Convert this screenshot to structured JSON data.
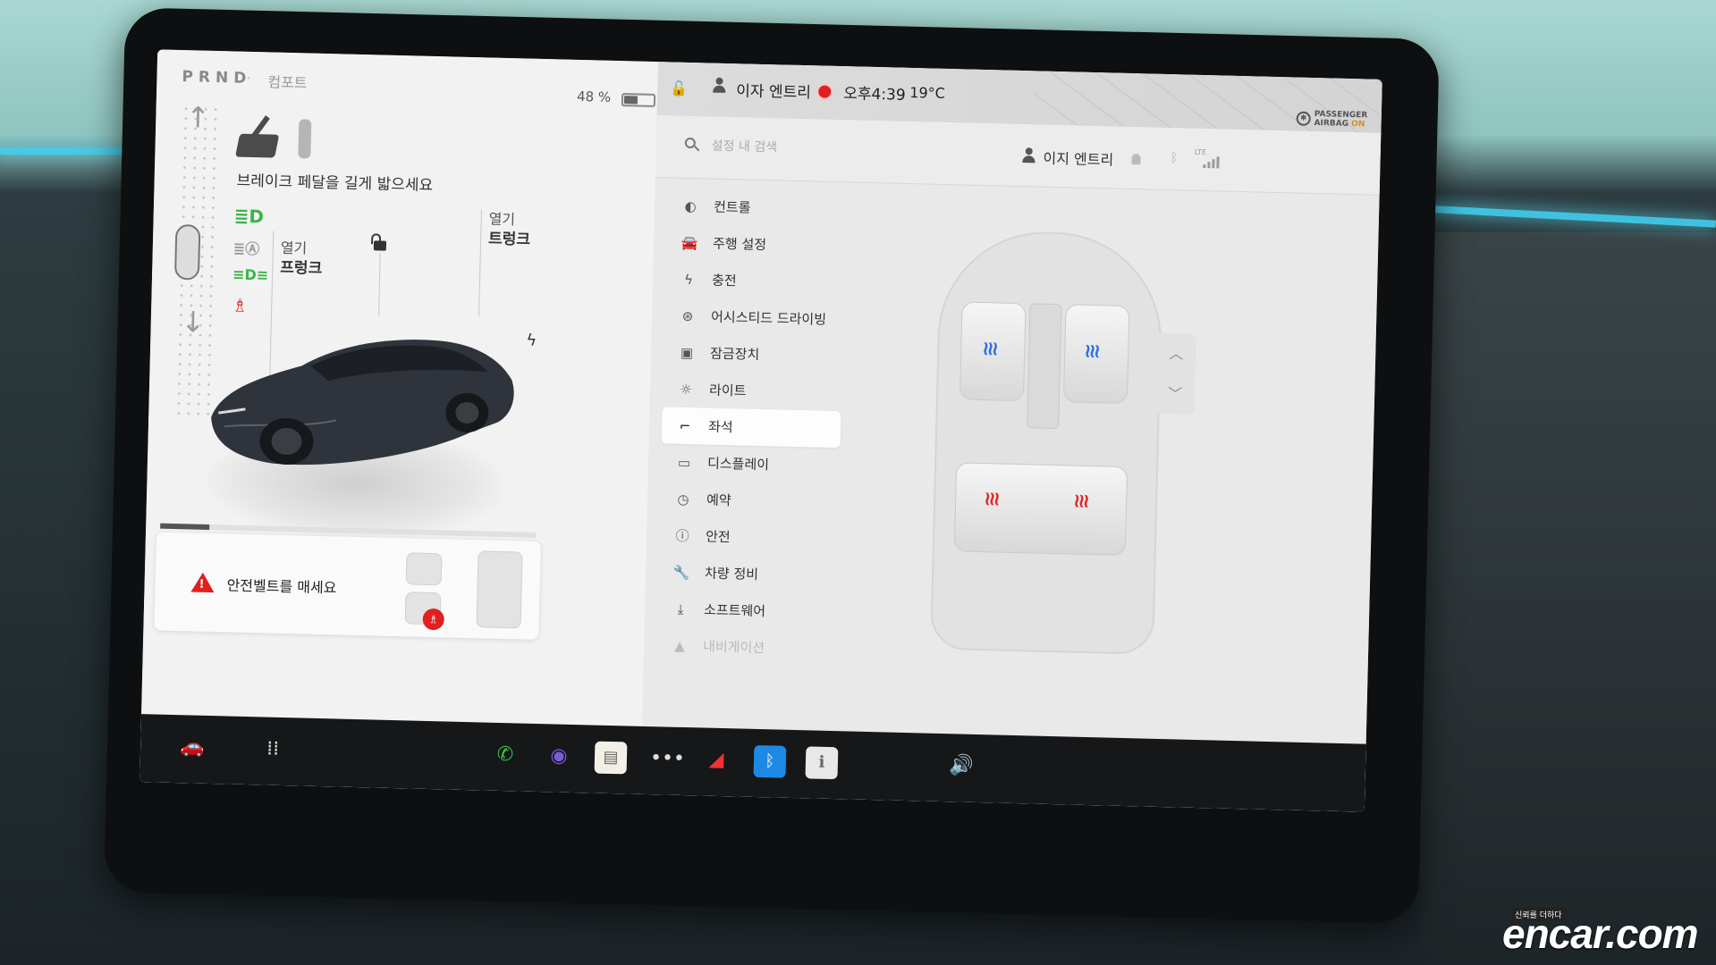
{
  "status": {
    "gears": "PRND",
    "drive_mode": "컴포트",
    "battery_percent": 48,
    "battery_label": "48 %"
  },
  "left_panel": {
    "brake_message": "브레이크 페달을 길게 밟으세요",
    "frunk": {
      "action": "열기",
      "name": "프렁크"
    },
    "trunk": {
      "action": "열기",
      "name": "트렁크"
    },
    "indicators": [
      {
        "icon": "headlight-icon",
        "color": "#3bb54a"
      },
      {
        "icon": "auto-headlight-icon",
        "color": "#9a9a9a"
      },
      {
        "icon": "parking-light-icon",
        "color": "#3bb54a"
      },
      {
        "icon": "seatbelt-warning-icon",
        "color": "#e02020"
      }
    ],
    "seatbelt_alert": "안전벨트를 매세요",
    "alert_progress": 0.13
  },
  "top_bar": {
    "profile_name": "이자 엔트리",
    "time": "오후4:39",
    "temperature": "19°C",
    "airbag_line1": "PASSENGER",
    "airbag_line2": "AIRBAG",
    "airbag_status": "ON"
  },
  "settings": {
    "search_placeholder": "설정 내 검색",
    "profile_name": "이지 엔트리",
    "lte": "LTE",
    "menu": [
      {
        "icon": "toggle-icon",
        "glyph": "◐",
        "label": "컨트롤"
      },
      {
        "icon": "car-icon",
        "glyph": "🚘",
        "label": "주행 설정"
      },
      {
        "icon": "lightning-icon",
        "glyph": "ϟ",
        "label": "충전"
      },
      {
        "icon": "steering-wheel-icon",
        "glyph": "⊛",
        "label": "어시스티드 드라이빙"
      },
      {
        "icon": "lock-icon",
        "glyph": "▣",
        "label": "잠금장치"
      },
      {
        "icon": "light-icon",
        "glyph": "☼",
        "label": "라이트"
      },
      {
        "icon": "seat-icon",
        "glyph": "⌐",
        "label": "좌석",
        "active": true
      },
      {
        "icon": "display-icon",
        "glyph": "▭",
        "label": "디스플레이"
      },
      {
        "icon": "clock-icon",
        "glyph": "◷",
        "label": "예약"
      },
      {
        "icon": "info-circle-icon",
        "glyph": "ⓘ",
        "label": "안전"
      },
      {
        "icon": "wrench-icon",
        "glyph": "🔧",
        "label": "차량 정비"
      },
      {
        "icon": "download-icon",
        "glyph": "⤓",
        "label": "소프트웨어"
      },
      {
        "icon": "navigation-icon",
        "glyph": "▲",
        "label": "내비게이션",
        "faded": true
      }
    ],
    "seat_heat": {
      "front_left": "blue",
      "front_right": "blue",
      "rear_left": "red",
      "rear_right": "red"
    }
  },
  "dock": {
    "items": [
      {
        "icon": "car-icon"
      },
      {
        "icon": "climate-icon"
      },
      {
        "icon": "phone-icon",
        "color": "#3cc24a"
      },
      {
        "icon": "camera-icon",
        "color": "#7b5bd6"
      },
      {
        "icon": "notes-icon",
        "color": "#f2f0e6"
      },
      {
        "icon": "more-icon"
      },
      {
        "icon": "tesla-app-icon",
        "color": "#e33"
      },
      {
        "icon": "bluetooth-icon",
        "color": "#1e88e5"
      },
      {
        "icon": "manual-icon",
        "color": "#e8e8e8"
      },
      {
        "icon": "volume-icon"
      }
    ]
  },
  "watermark": {
    "brand": "encar.com",
    "tagline": "신뢰를 더하다"
  }
}
